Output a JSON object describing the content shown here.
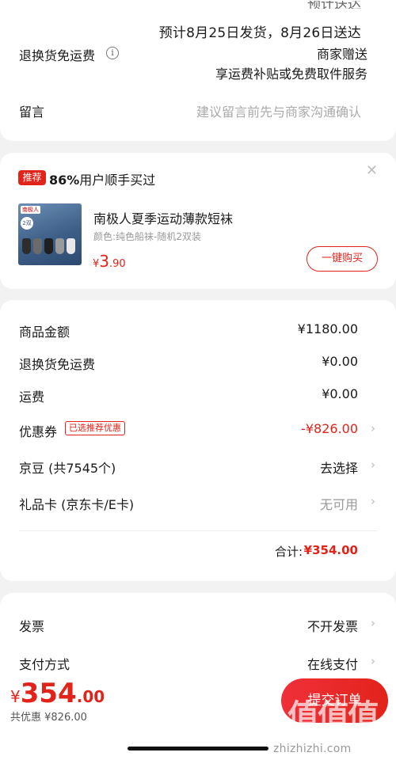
{
  "delivery": {
    "cut_top_text": "预计送达",
    "estimate": "预计8月25日发货，8月26日送达"
  },
  "return_shipping": {
    "label": "退换货免运费",
    "info_icon": "info-circle-icon",
    "value_line1": "商家赠送",
    "value_line2": "享运费补贴或免费取件服务"
  },
  "message": {
    "label": "留言",
    "placeholder": "建议留言前先与商家沟通确认"
  },
  "recommend": {
    "tag": "推荐",
    "percent": "86%",
    "title_rest": "用户顺手买过",
    "close_icon": "close-icon",
    "image_brand": "南极人",
    "image_pairs": "2双",
    "product_name": "南极人夏季运动薄款短袜",
    "product_spec": "颜色:纯色船袜-随机2双装",
    "price_currency": "¥",
    "price_int": "3",
    "price_dec": ".90",
    "buy_button": "一键购买"
  },
  "amounts": {
    "goods_label": "商品金额",
    "goods_value": "¥1180.00",
    "return_label": "退换货免运费",
    "return_value": "¥0.00",
    "shipping_label": "运费",
    "shipping_value": "¥0.00",
    "coupon_label": "优惠券",
    "coupon_tag": "已选推荐优惠",
    "coupon_value": "-¥826.00",
    "beans_label": "京豆 (共7545个)",
    "beans_value": "去选择",
    "giftcard_label": "礼品卡 (京东卡/E卡)",
    "giftcard_value": "无可用",
    "total_label": "合计:",
    "total_value": "¥354.00"
  },
  "invoice": {
    "label": "发票",
    "value": "不开发票"
  },
  "payment": {
    "label": "支付方式",
    "value": "在线支付"
  },
  "footer": {
    "price_currency": "¥",
    "price_int": "354",
    "price_dec": ".00",
    "saved": "共优惠 ¥826.00",
    "submit": "提交订单"
  },
  "watermark": {
    "logo": "值值值",
    "url": "zhizhizhi.com"
  },
  "colors": {
    "accent": "#e2231a",
    "background": "#f2f2f2"
  }
}
